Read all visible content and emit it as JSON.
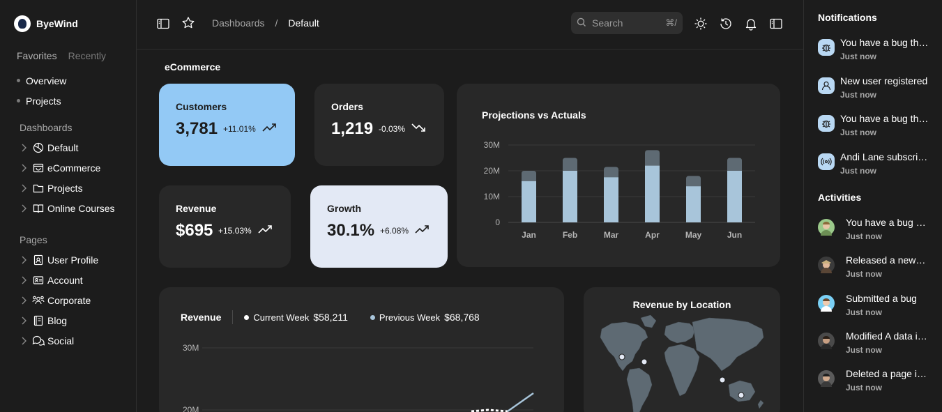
{
  "brand": {
    "name": "ByeWind"
  },
  "sidebar": {
    "tabs": [
      "Favorites",
      "Recently"
    ],
    "favorites": [
      "Overview",
      "Projects"
    ],
    "dashboards_label": "Dashboards",
    "dashboards": [
      {
        "label": "Default",
        "icon": "pie-chart-icon"
      },
      {
        "label": "eCommerce",
        "icon": "shopping-bag-icon"
      },
      {
        "label": "Projects",
        "icon": "folder-icon"
      },
      {
        "label": "Online Courses",
        "icon": "book-icon"
      }
    ],
    "pages_label": "Pages",
    "pages": [
      {
        "label": "User Profile",
        "icon": "id-badge-icon"
      },
      {
        "label": "Account",
        "icon": "id-card-icon"
      },
      {
        "label": "Corporate",
        "icon": "users-icon"
      },
      {
        "label": "Blog",
        "icon": "notebook-icon"
      },
      {
        "label": "Social",
        "icon": "chat-bubbles-icon"
      }
    ]
  },
  "topbar": {
    "breadcrumb": [
      "Dashboards",
      "/",
      "Default"
    ],
    "search_placeholder": "Search",
    "search_shortcut": "⌘/"
  },
  "main": {
    "title": "eCommerce",
    "kpis": [
      {
        "label": "Customers",
        "value": "3,781",
        "delta": "+11.01%",
        "trend": "up"
      },
      {
        "label": "Orders",
        "value": "1,219",
        "delta": "-0.03%",
        "trend": "down"
      },
      {
        "label": "Revenue",
        "value": "$695",
        "delta": "+15.03%",
        "trend": "up"
      },
      {
        "label": "Growth",
        "value": "30.1%",
        "delta": "+6.08%",
        "trend": "up"
      }
    ],
    "projections_title": "Projections vs Actuals",
    "revenue": {
      "title": "Revenue",
      "current_label": "Current Week",
      "current_value": "$58,211",
      "previous_label": "Previous Week",
      "previous_value": "$68,768",
      "ticks": [
        "30M",
        "20M"
      ]
    },
    "location_title": "Revenue by Location"
  },
  "chart_data": [
    {
      "type": "bar",
      "title": "Projections vs Actuals",
      "categories": [
        "Jan",
        "Feb",
        "Mar",
        "Apr",
        "May",
        "Jun"
      ],
      "y_ticks": [
        "30M",
        "20M",
        "10M",
        "0"
      ],
      "ylim": [
        0,
        30
      ],
      "series": [
        {
          "values": [
            16,
            20,
            17.5,
            22,
            14,
            20
          ]
        },
        {
          "values": [
            20,
            25,
            21.5,
            28,
            18,
            25
          ]
        }
      ],
      "colors": [
        "#a8c5da",
        "#5e6a73"
      ]
    }
  ],
  "notifications_title": "Notifications",
  "notifications": [
    {
      "text": "You have a bug that needs...",
      "time": "Just now",
      "icon": "bug-icon"
    },
    {
      "text": "New user registered",
      "time": "Just now",
      "icon": "user-icon"
    },
    {
      "text": "You have a bug that needs...",
      "time": "Just now",
      "icon": "bug-icon"
    },
    {
      "text": "Andi Lane subscribed to you",
      "time": "Just now",
      "icon": "broadcast-icon"
    }
  ],
  "activities_title": "Activities",
  "activities": [
    {
      "text": "You have a bug that needs...",
      "time": "Just now"
    },
    {
      "text": "Released a new version",
      "time": "Just now"
    },
    {
      "text": "Submitted a bug",
      "time": "Just now"
    },
    {
      "text": "Modified A data in Page X",
      "time": "Just now"
    },
    {
      "text": "Deleted a page in Project X",
      "time": "Just now"
    }
  ],
  "colors": {
    "background": "#1c1c1c",
    "card": "#282828",
    "accent_blue": "#93c9f5",
    "accent_light": "#e3e9f5",
    "bar_actual": "#a8c5da",
    "bar_projection": "#5e6a73"
  }
}
